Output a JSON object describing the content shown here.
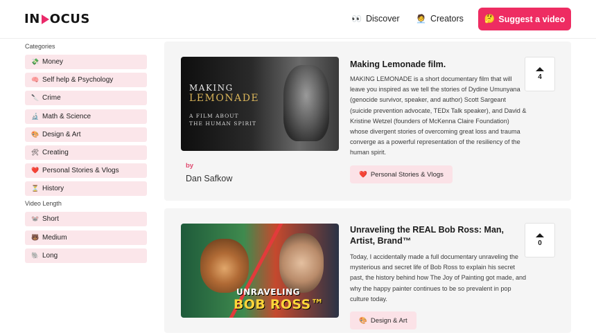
{
  "header": {
    "logo": {
      "left": "IN",
      "right": "OCUS"
    },
    "nav": [
      {
        "icon": "👀",
        "label": "Discover"
      },
      {
        "icon": "🧑‍💼",
        "label": "Creators"
      }
    ],
    "suggest_button": {
      "icon": "🤔",
      "label": "Suggest a video"
    }
  },
  "sidebar": {
    "categories_label": "Categories",
    "categories": [
      {
        "icon": "💸",
        "label": "Money"
      },
      {
        "icon": "🧠",
        "label": "Self help & Psychology"
      },
      {
        "icon": "🔪",
        "label": "Crime"
      },
      {
        "icon": "🔬",
        "label": "Math & Science"
      },
      {
        "icon": "🎨",
        "label": "Design & Art"
      },
      {
        "icon": "🛠",
        "label": "Creating"
      },
      {
        "icon": "❤️",
        "label": "Personal Stories & Vlogs"
      },
      {
        "icon": "⏳",
        "label": "History"
      }
    ],
    "length_label": "Video Length",
    "lengths": [
      {
        "icon": "🐭",
        "label": "Short"
      },
      {
        "icon": "🐻",
        "label": "Medium"
      },
      {
        "icon": "🐘",
        "label": "Long"
      }
    ]
  },
  "videos": [
    {
      "title": "Making Lemonade film.",
      "thumbnail": {
        "line1": "MAKING",
        "line2": "LEMONADE",
        "line3": "A FILM ABOUT",
        "line4": "THE HUMAN SPIRIT"
      },
      "by_label": "by",
      "author": "Dan Safkow",
      "description": "MAKING LEMONADE is a short documentary film that will leave you inspired as we tell the stories of Dydine Umunyana (genocide survivor, speaker, and author) Scott Sargeant (suicide prevention advocate, TEDx Talk speaker), and David & Kristine Wetzel (founders of McKenna Claire Foundation) whose divergent stories of overcoming great loss and trauma converge as a powerful representation of the resiliency of the human spirit.",
      "tag": {
        "icon": "❤️",
        "label": "Personal Stories & Vlogs"
      },
      "votes": "4"
    },
    {
      "title": "Unraveling the REAL Bob Ross: Man, Artist, Brand™",
      "thumbnail": {
        "line1": "UNRAVELING",
        "line2": "BOB ROSS™"
      },
      "description": "Today, I accidentally made a full documentary unraveling the mysterious and secret life of Bob Ross to explain his secret past, the history behind how The Joy of Painting got made, and why the happy painter continues to be so prevalent in pop culture today.",
      "tag": {
        "icon": "🎨",
        "label": "Design & Art"
      },
      "votes": "0"
    }
  ]
}
